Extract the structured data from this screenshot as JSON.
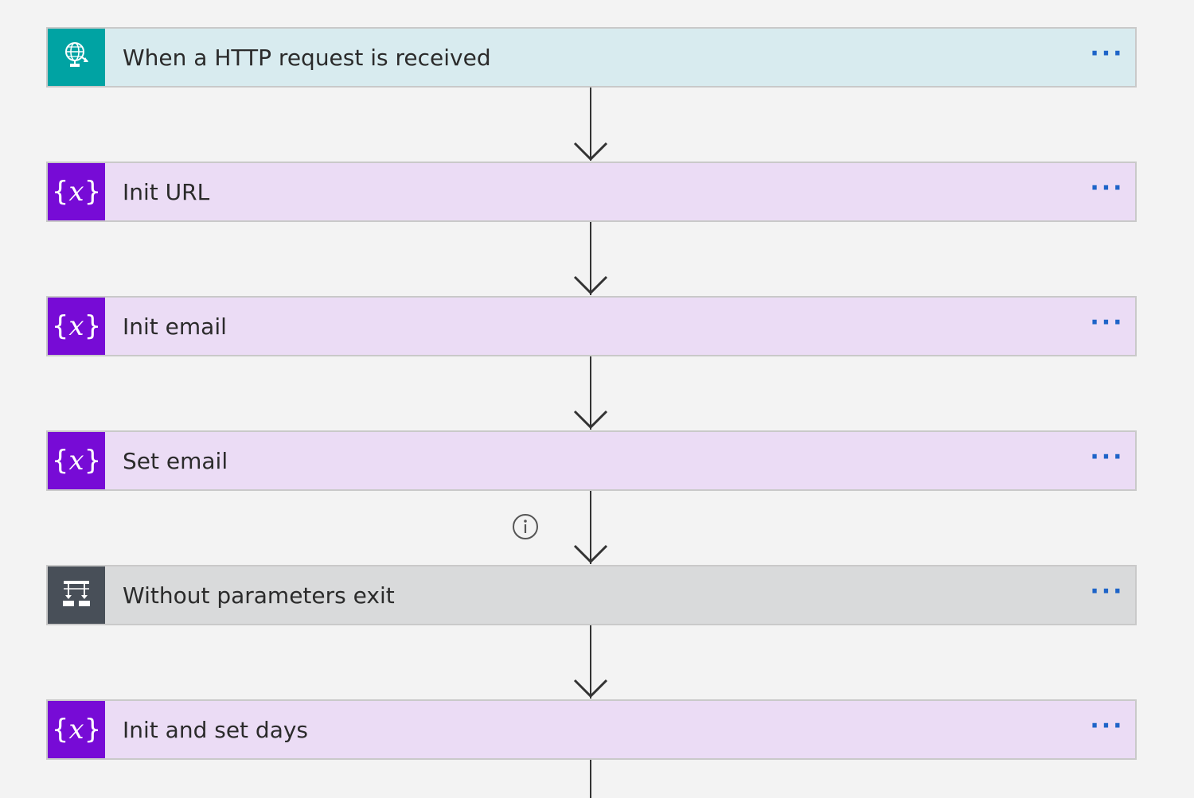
{
  "flow": {
    "steps": [
      {
        "label": "When a HTTP request is received",
        "kind": "trigger",
        "icon": "globe-icon",
        "more": "···"
      },
      {
        "label": "Init URL",
        "kind": "variable",
        "icon": "variable-icon",
        "more": "···"
      },
      {
        "label": "Init email",
        "kind": "variable",
        "icon": "variable-icon",
        "more": "···"
      },
      {
        "label": "Set email",
        "kind": "variable",
        "icon": "variable-icon",
        "more": "···"
      },
      {
        "label": "Without parameters exit",
        "kind": "condition",
        "icon": "condition-icon",
        "more": "···"
      },
      {
        "label": "Init and set days",
        "kind": "variable",
        "icon": "variable-icon",
        "more": "···"
      }
    ]
  },
  "colors": {
    "canvas_bg": "#f3f3f3",
    "trigger_icon_bg": "#00a3a3",
    "trigger_body_bg": "#d8ebef",
    "variable_icon_bg": "#770bd6",
    "variable_body_bg": "#ebdcf5",
    "condition_icon_bg": "#484f58",
    "condition_body_bg": "#d9dadb",
    "more_dots": "#1e64c8",
    "connector": "#333333"
  }
}
